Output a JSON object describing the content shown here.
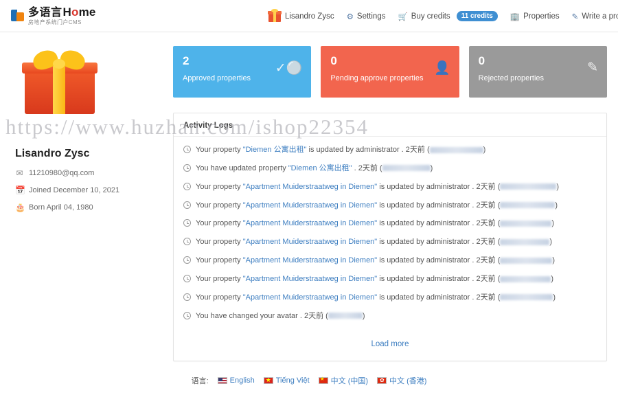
{
  "header": {
    "logo_cn": "多语言",
    "logo_en_pre": "H",
    "logo_en_mid": "o",
    "logo_en_post": "me",
    "logo_sub": "房地产系统门户CMS",
    "nav": [
      {
        "label": "Lisandro Zysc",
        "icon": "gift-icon"
      },
      {
        "label": "Settings",
        "icon": "gear-icon"
      },
      {
        "label": "Buy credits",
        "icon": "cart-icon",
        "badge": "11 credits"
      },
      {
        "label": "Properties",
        "icon": "building-icon"
      },
      {
        "label": "Write a property",
        "icon": "pencil-icon"
      },
      {
        "label": "",
        "icon": "logout-icon"
      }
    ]
  },
  "profile": {
    "name": "Lisandro Zysc",
    "email": "11210980@qq.com",
    "joined": "Joined December 10, 2021",
    "born": "Born April 04, 1980"
  },
  "stats": [
    {
      "value": "2",
      "label": "Approved properties",
      "color": "#4eb3ea",
      "icon": "check-circle-icon"
    },
    {
      "value": "0",
      "label": "Pending approve properties",
      "color": "#f2654e",
      "icon": "user-clock-icon"
    },
    {
      "value": "0",
      "label": "Rejected properties",
      "color": "#9a9a9a",
      "icon": "edit-square-icon"
    }
  ],
  "activity": {
    "title": "Activity Logs",
    "load_more": "Load more",
    "items": [
      {
        "pre": "Your property ",
        "link": "Diemen 公寓出租",
        "post": " is updated by administrator . ",
        "time": "2天前",
        "tail_blur": 78
      },
      {
        "pre": "You have updated property ",
        "link": "Diemen 公寓出租",
        "post": " . ",
        "time": "2天前",
        "tail_blur": 70
      },
      {
        "pre": "Your property ",
        "link": "Apartment Muiderstraatweg in Diemen",
        "post": " is updated by administrator . ",
        "time": "2天前",
        "tail_blur": 82
      },
      {
        "pre": "Your property ",
        "link": "Apartment Muiderstraatweg in Diemen",
        "post": " is updated by administrator . ",
        "time": "2天前",
        "tail_blur": 80
      },
      {
        "pre": "Your property ",
        "link": "Apartment Muiderstraatweg in Diemen",
        "post": " is updated by administrator . ",
        "time": "2天前",
        "tail_blur": 75
      },
      {
        "pre": "Your property ",
        "link": "Apartment Muiderstraatweg in Diemen",
        "post": " is updated by administrator . ",
        "time": "2天前",
        "tail_blur": 72
      },
      {
        "pre": "Your property ",
        "link": "Apartment Muiderstraatweg in Diemen",
        "post": " is updated by administrator . ",
        "time": "2天前",
        "tail_blur": 76
      },
      {
        "pre": "Your property ",
        "link": "Apartment Muiderstraatweg in Diemen",
        "post": " is updated by administrator . ",
        "time": "2天前",
        "tail_blur": 74
      },
      {
        "pre": "Your property ",
        "link": "Apartment Muiderstraatweg in Diemen",
        "post": " is updated by administrator . ",
        "time": "2天前",
        "tail_blur": 77
      },
      {
        "pre": "You have changed your avatar . ",
        "link": "",
        "post": "",
        "time": "2天前",
        "tail_blur": 50
      }
    ]
  },
  "watermark": "https://www.huzhan.com/ishop22354",
  "footer": {
    "label": "语言:",
    "languages": [
      {
        "label": "English",
        "flag": "flag-us"
      },
      {
        "label": "Tiếng Việt",
        "flag": "flag-vn"
      },
      {
        "label": "中文 (中国)",
        "flag": "flag-cn"
      },
      {
        "label": "中文 (香港)",
        "flag": "flag-hk"
      }
    ]
  }
}
